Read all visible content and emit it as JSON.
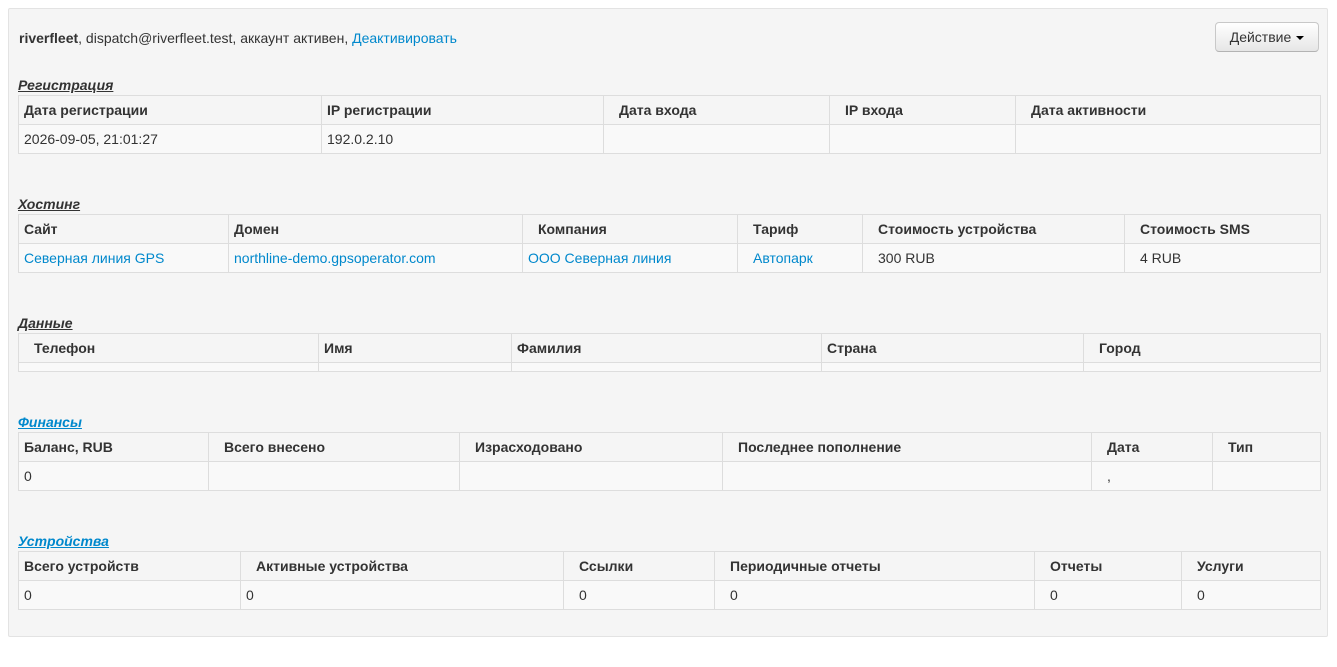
{
  "header": {
    "username": "riverfleet",
    "info": ", dispatch@riverfleet.test, аккаунт активен, ",
    "deactivate_link": "Деактивировать",
    "action_button": "Действие"
  },
  "registration": {
    "title": "Регистрация",
    "columns": [
      "Дата регистрации",
      "IP регистрации",
      "Дата входа",
      "IP входа",
      "Дата активности"
    ],
    "row": [
      "2026-09-05, 21:01:27",
      "192.0.2.10",
      "",
      "",
      ""
    ]
  },
  "hosting": {
    "title": "Хостинг",
    "columns": [
      "Сайт",
      "Домен",
      "Компания",
      "Тариф",
      "Стоимость устройства",
      "Стоимость SMS"
    ],
    "row": [
      "Северная линия GPS",
      "northline-demo.gpsoperator.com",
      "ООО Северная линия",
      "Автопарк",
      "300 RUB",
      "4 RUB"
    ]
  },
  "data": {
    "title": "Данные",
    "columns": [
      "Телефон",
      "Имя",
      "Фамилия",
      "Страна",
      "Город"
    ]
  },
  "finance": {
    "title": "Финансы",
    "columns": [
      "Баланс, RUB",
      "Всего внесено",
      "Израсходовано",
      "Последнее пополнение",
      "Дата",
      "Тип"
    ],
    "row": [
      "0",
      "",
      "",
      "",
      ",",
      ""
    ]
  },
  "devices": {
    "title": "Устройства",
    "columns": [
      "Всего устройств",
      "Активные устройства",
      "Ссылки",
      "Периодичные отчеты",
      "Отчеты",
      "Услуги"
    ],
    "row": [
      "0",
      "0",
      "0",
      "0",
      "0",
      "0"
    ]
  },
  "colors": {
    "link": "#0088cc",
    "panel_bg": "#f5f5f5",
    "border": "#dddddd"
  }
}
